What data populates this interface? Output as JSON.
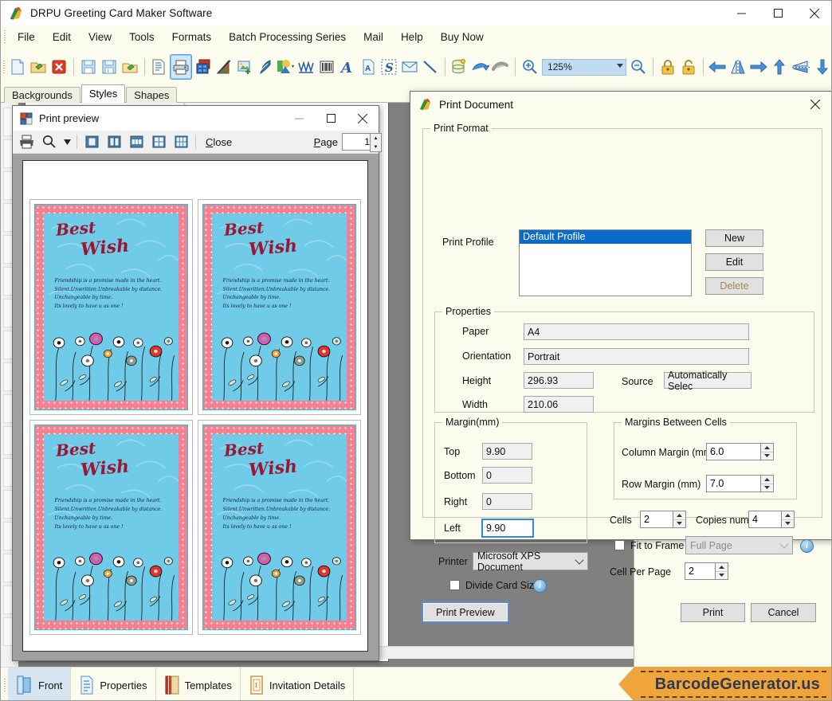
{
  "window": {
    "title": "DRPU Greeting Card Maker Software",
    "app_icon": "app-logo-icon",
    "minimize": "–",
    "maximize": "☐",
    "close": "✕"
  },
  "menu": {
    "items": [
      "File",
      "Edit",
      "View",
      "Tools",
      "Formats",
      "Batch Processing Series",
      "Mail",
      "Help",
      "Buy Now"
    ]
  },
  "toolbar": {
    "zoom_value": "125%",
    "items": [
      {
        "name": "new-document-icon",
        "tip": "New"
      },
      {
        "name": "open-folder-icon",
        "tip": "Open"
      },
      {
        "name": "close-document-icon",
        "tip": "Close"
      },
      {
        "name": "save-icon",
        "tip": "Save"
      },
      {
        "name": "save-as-icon",
        "tip": "Save As"
      },
      {
        "name": "export-icon",
        "tip": "Export"
      },
      {
        "name": "page-setup-icon",
        "tip": "Page Setup"
      },
      {
        "name": "print-icon",
        "tip": "Print"
      },
      {
        "name": "background-icon",
        "tip": "Background"
      },
      {
        "name": "gradient-icon",
        "tip": "Gradient"
      },
      {
        "name": "insert-image-icon",
        "tip": "Insert Image"
      },
      {
        "name": "pen-icon",
        "tip": "Pen"
      },
      {
        "name": "shapes-icon",
        "tip": "Shapes"
      },
      {
        "name": "watermark-icon",
        "tip": "Watermark"
      },
      {
        "name": "barcode-icon",
        "tip": "Barcode"
      },
      {
        "name": "text-icon",
        "tip": "Text"
      },
      {
        "name": "text-page-icon",
        "tip": "Text Page"
      },
      {
        "name": "signature-icon",
        "tip": "Signature"
      },
      {
        "name": "mail-icon",
        "tip": "Mail"
      },
      {
        "name": "line-icon",
        "tip": "Line"
      },
      {
        "name": "database-icon",
        "tip": "Database"
      },
      {
        "name": "undo-icon",
        "tip": "Undo"
      },
      {
        "name": "redo-icon",
        "tip": "Redo"
      },
      {
        "name": "zoom-in-icon",
        "tip": "Zoom In"
      },
      {
        "name": "zoom-out-icon",
        "tip": "Zoom Out"
      },
      {
        "name": "lock-icon",
        "tip": "Lock"
      },
      {
        "name": "unlock-icon",
        "tip": "Unlock"
      },
      {
        "name": "align-left-icon",
        "tip": "Align Left"
      },
      {
        "name": "flip-horizontal-icon",
        "tip": "Flip Horizontal"
      },
      {
        "name": "align-right-icon",
        "tip": "Align Right"
      },
      {
        "name": "align-top-icon",
        "tip": "Align Top"
      },
      {
        "name": "flip-vertical-icon",
        "tip": "Flip Vertical"
      },
      {
        "name": "align-bottom-icon",
        "tip": "Align Bottom"
      }
    ]
  },
  "tabs": {
    "items": [
      "Backgrounds",
      "Styles",
      "Shapes"
    ],
    "selected": "Styles"
  },
  "card": {
    "title_line1": "Best",
    "title_line2": "Wish",
    "body_lines": [
      "Friendship is a promise made in the heart.",
      "Silent.Unwritten.Unbreakable by distance.",
      "Unchangeable by time.",
      "Its lovely to have u as one !"
    ],
    "colors": {
      "inner_blue": "#6fcbe8",
      "border_pink": "#f4818f",
      "accent_cyan": "#16c8e0",
      "title_maroon": "#9c1633"
    }
  },
  "print_preview": {
    "title": "Print preview",
    "icon": "print-preview-icon",
    "minimize": "–",
    "maximize": "☐",
    "close": "✕",
    "toolbar": {
      "print_icon": "print-icon",
      "zoom_icon": "magnifier-icon",
      "zoom_dropdown_arrow": "▾",
      "one_page_icon": "one-page-view-icon",
      "two_page_icon": "two-page-view-icon",
      "three_page_icon": "three-page-view-icon",
      "four_page_icon": "four-page-view-icon",
      "six_page_icon": "six-page-view-icon",
      "close_label": "Close",
      "page_label": "Page",
      "page_value": "1"
    }
  },
  "print_dialog": {
    "title": "Print Document",
    "icon": "app-logo-icon",
    "close": "✕",
    "print_format": {
      "group_label": "Print Format",
      "profile_label": "Print Profile",
      "profiles": [
        "Default Profile"
      ],
      "selected_profile": "Default Profile",
      "new_button": "New",
      "edit_button": "Edit",
      "delete_button": "Delete"
    },
    "properties": {
      "group_label": "Properties",
      "paper_label": "Paper",
      "paper_value": "A4",
      "orientation_label": "Orientation",
      "orientation_value": "Portrait",
      "height_label": "Height",
      "height_value": "296.93",
      "width_label": "Width",
      "width_value": "210.06",
      "source_label": "Source",
      "source_value": "Automatically Selec"
    },
    "margin": {
      "group_label": "Margin(mm)",
      "top_label": "Top",
      "top_value": "9.90",
      "bottom_label": "Bottom",
      "bottom_value": "0",
      "right_label": "Right",
      "right_value": "0",
      "left_label": "Left",
      "left_value": "9.90"
    },
    "margins_between_cells": {
      "group_label": "Margins Between Cells",
      "column_margin_label": "Column Margin (mm)",
      "column_margin_value": "6.0",
      "row_margin_label": "Row Margin (mm)",
      "row_margin_value": "7.0"
    },
    "cells_label": "Cells",
    "cells_value": "2",
    "copies_label": "Copies number",
    "copies_value": "4",
    "fit_to_frame_label": "Fit to Frame",
    "fit_to_frame_checked": false,
    "fit_to_frame_option": "Full Page",
    "cell_per_page_label": "Cell Per Page",
    "cell_per_page_value": "2",
    "printer_label": "Printer",
    "printer_value": "Microsoft XPS Document",
    "divide_card_size_label": "Divide Card Size",
    "divide_card_size_checked": false,
    "info_icon": "info-icon",
    "print_preview_button": "Print Preview",
    "print_button": "Print",
    "cancel_button": "Cancel"
  },
  "statusbar": {
    "items": [
      {
        "label": "Front",
        "icon": "front-panel-icon",
        "selected": true
      },
      {
        "label": "Properties",
        "icon": "properties-icon",
        "selected": false
      },
      {
        "label": "Templates",
        "icon": "templates-icon",
        "selected": false
      },
      {
        "label": "Invitation Details",
        "icon": "invitation-details-icon",
        "selected": false
      }
    ],
    "brand": "BarcodeGenerator.us"
  }
}
